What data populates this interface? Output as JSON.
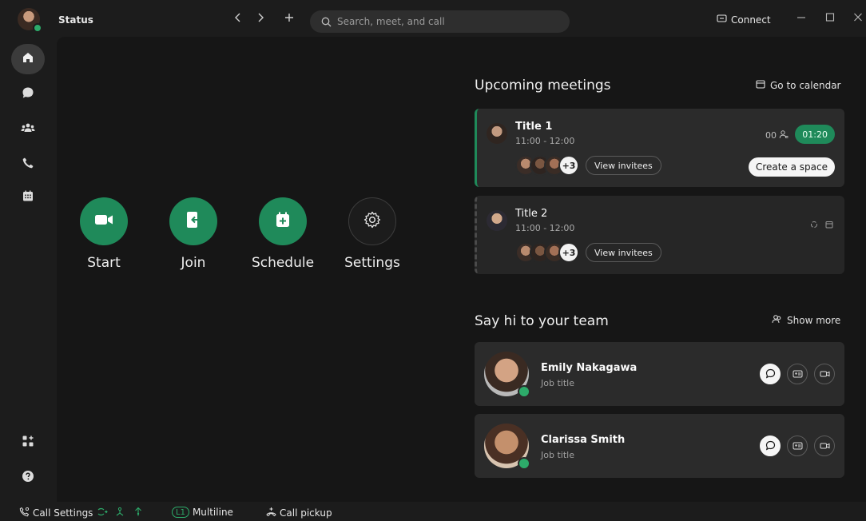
{
  "titlebar": {
    "status_label": "Status",
    "back_icon": "chevron-left-icon",
    "forward_icon": "chevron-right-icon",
    "add_icon": "plus-icon",
    "search_placeholder": "Search, meet, and call",
    "connect_label": "Connect",
    "window_controls": [
      "minimize-icon",
      "maximize-icon",
      "close-icon"
    ]
  },
  "rail": {
    "items": [
      {
        "icon": "home-icon",
        "active": true
      },
      {
        "icon": "messaging-icon",
        "active": false
      },
      {
        "icon": "teams-icon",
        "active": false
      },
      {
        "icon": "phone-icon",
        "active": false
      },
      {
        "icon": "calendar-icon",
        "active": false
      }
    ],
    "bottom": [
      {
        "icon": "apps-icon"
      },
      {
        "icon": "help-icon"
      }
    ]
  },
  "quick_actions": [
    {
      "label": "Start",
      "icon": "video-camera-icon",
      "style": "green"
    },
    {
      "label": "Join",
      "icon": "join-icon",
      "style": "green"
    },
    {
      "label": "Schedule",
      "icon": "calendar-add-icon",
      "style": "green"
    },
    {
      "label": "Settings",
      "icon": "gear-icon",
      "style": "dark"
    }
  ],
  "upcoming": {
    "title": "Upcoming meetings",
    "calendar_link": "Go to calendar",
    "meetings": [
      {
        "title": "Title 1",
        "time": "11:00 - 12:00",
        "invitee_more": "+3",
        "view_invitees": "View invitees",
        "attendee_count": "00",
        "timer": "01:20",
        "create_space": "Create a space"
      },
      {
        "title": "Title 2",
        "time": "11:00 - 12:00",
        "invitee_more": "+3",
        "view_invitees": "View invitees"
      }
    ]
  },
  "team": {
    "title": "Say hi to your team",
    "show_more": "Show more",
    "members": [
      {
        "name": "Emily Nakagawa",
        "job": "Job title"
      },
      {
        "name": "Clarissa Smith",
        "job": "Job title"
      }
    ]
  },
  "statusbar": {
    "call_settings": "Call Settings",
    "multiline_badge": "L1",
    "multiline": "Multiline",
    "call_pickup": "Call pickup"
  },
  "colors": {
    "accent": "#1f8a5a",
    "presence": "#2dab6a",
    "background": "#1c1c1c",
    "panel": "#161616",
    "card": "#2b2b2b"
  }
}
